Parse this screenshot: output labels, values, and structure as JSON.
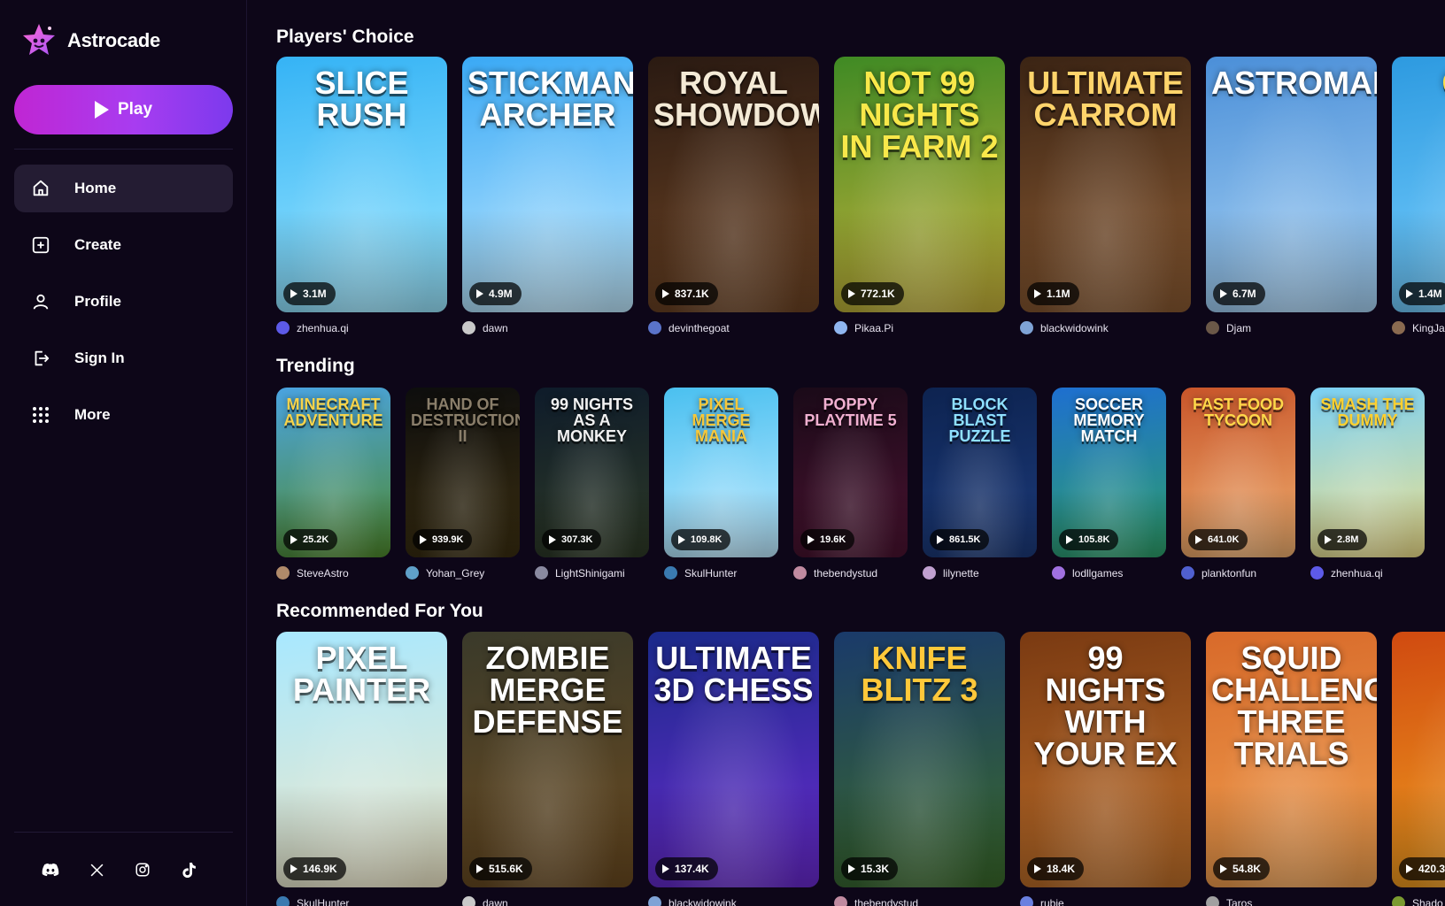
{
  "app": {
    "name": "Astrocade"
  },
  "sidebar": {
    "play_label": "Play",
    "nav": [
      {
        "label": "Home",
        "icon": "home-icon",
        "active": true
      },
      {
        "label": "Create",
        "icon": "plus-square-icon",
        "active": false
      },
      {
        "label": "Profile",
        "icon": "user-icon",
        "active": false
      },
      {
        "label": "Sign In",
        "icon": "sign-in-icon",
        "active": false
      },
      {
        "label": "More",
        "icon": "grid-icon",
        "active": false
      }
    ],
    "social": [
      "discord-icon",
      "x-icon",
      "instagram-icon",
      "tiktok-icon"
    ]
  },
  "sections": [
    {
      "title": "Players' Choice",
      "size": "big",
      "games": [
        {
          "title": "Slice Rush",
          "plays": "3.1M",
          "author": "zhenhua.qi",
          "bg": [
            "#35b3f5",
            "#9be7ff"
          ],
          "avatar": "#5d5ae8",
          "title_color": "#ffffff"
        },
        {
          "title": "Stickman Archer",
          "plays": "4.9M",
          "author": "dawn",
          "bg": [
            "#3aa9f5",
            "#bfe9ff"
          ],
          "avatar": "#c9c9c9",
          "title_color": "#ffffff"
        },
        {
          "title": "Royal Showdown",
          "plays": "837.1K",
          "author": "devinthegoat",
          "bg": [
            "#2a1a12",
            "#6e4424"
          ],
          "avatar": "#5a73c9",
          "title_color": "#f4ead6"
        },
        {
          "title": "Not 99 Nights in Farm 2",
          "plays": "772.1K",
          "author": "Pikaa.Pi",
          "bg": [
            "#3f8a24",
            "#c7b23a"
          ],
          "avatar": "#8fb6f0",
          "title_color": "#f9e84a"
        },
        {
          "title": "Ultimate Carrom",
          "plays": "1.1M",
          "author": "blackwidowink",
          "bg": [
            "#3b2414",
            "#8a5a32"
          ],
          "avatar": "#7fa3d6",
          "title_color": "#ffd46b"
        },
        {
          "title": "Astroman",
          "plays": "6.7M",
          "author": "Djam",
          "bg": [
            "#4b8fd8",
            "#a9d4f5"
          ],
          "avatar": "#6b5848",
          "title_color": "#ffffff"
        },
        {
          "title": "Gun",
          "plays": "1.4M",
          "author": "KingJa",
          "bg": [
            "#2d9ae0",
            "#7ad0ff"
          ],
          "avatar": "#8a6a50",
          "title_color": "#ffe04a"
        }
      ]
    },
    {
      "title": "Trending",
      "size": "small",
      "games": [
        {
          "title": "Minecraft Adventure",
          "plays": "25.2K",
          "author": "SteveAstro",
          "bg": [
            "#4aa3e0",
            "#4f8a2c"
          ],
          "avatar": "#b08a6a",
          "title_color": "#f7d34a"
        },
        {
          "title": "Hand of Destruction II",
          "plays": "939.9K",
          "author": "Yohan_Grey",
          "bg": [
            "#0d0d0d",
            "#3a2e10"
          ],
          "avatar": "#5fa0c8",
          "title_color": "#8a7e6a"
        },
        {
          "title": "99 Nights as a Monkey",
          "plays": "307.3K",
          "author": "LightShinigami",
          "bg": [
            "#0e1b2a",
            "#2e3a26"
          ],
          "avatar": "#8a8aa0",
          "title_color": "#f2f2f2"
        },
        {
          "title": "Pixel Merge Mania",
          "plays": "109.8K",
          "author": "SkulHunter",
          "bg": [
            "#4ac0f0",
            "#bfeaff"
          ],
          "avatar": "#3a7ab0",
          "title_color": "#f6c73a"
        },
        {
          "title": "Poppy Playtime 5",
          "plays": "19.6K",
          "author": "thebendystud",
          "bg": [
            "#1a0a18",
            "#4a1230"
          ],
          "avatar": "#c08aa0",
          "title_color": "#f0b0d0"
        },
        {
          "title": "Block Blast Puzzle",
          "plays": "861.5K",
          "author": "lilynette",
          "bg": [
            "#0d2350",
            "#1c3a7a"
          ],
          "avatar": "#c0a0d0",
          "title_color": "#8fe0ff"
        },
        {
          "title": "Soccer Memory Match",
          "plays": "105.8K",
          "author": "lodllgames",
          "bg": [
            "#1e6fd0",
            "#2ea06a"
          ],
          "avatar": "#a070e0",
          "title_color": "#ffffff"
        },
        {
          "title": "Fast Food Tycoon",
          "plays": "641.0K",
          "author": "planktonfun",
          "bg": [
            "#c8552a",
            "#f0b070"
          ],
          "avatar": "#5060d0",
          "title_color": "#ffd84a"
        },
        {
          "title": "Smash the Dummy",
          "plays": "2.8M",
          "author": "zhenhua.qi",
          "bg": [
            "#7ad0f5",
            "#f0e08a"
          ],
          "avatar": "#5d5ae8",
          "title_color": "#ffd02e"
        }
      ]
    },
    {
      "title": "Recommended For You",
      "size": "big",
      "games": [
        {
          "title": "Pixel Painter",
          "plays": "146.9K",
          "author": "SkulHunter",
          "bg": [
            "#a8e8ff",
            "#f0e8c8"
          ],
          "avatar": "#3a7ab0",
          "title_color": "#ffffff"
        },
        {
          "title": "Zombie Merge Defense",
          "plays": "515.6K",
          "author": "dawn",
          "bg": [
            "#3a3a2a",
            "#6a4a20"
          ],
          "avatar": "#c9c9c9",
          "title_color": "#ffffff"
        },
        {
          "title": "Ultimate 3D Chess",
          "plays": "137.4K",
          "author": "blackwidowink",
          "bg": [
            "#1a2a8a",
            "#6a2ad0"
          ],
          "avatar": "#7fa3d6",
          "title_color": "#ffffff"
        },
        {
          "title": "Knife Blitz 3",
          "plays": "15.3K",
          "author": "thebendystud",
          "bg": [
            "#1a3a6a",
            "#3a6a2a"
          ],
          "avatar": "#c08aa0",
          "title_color": "#ffc83a"
        },
        {
          "title": "99 Nights with Your Ex",
          "plays": "18.4K",
          "author": "rubie",
          "bg": [
            "#7a3a12",
            "#c0702a"
          ],
          "avatar": "#6a80e0",
          "title_color": "#ffffff"
        },
        {
          "title": "Squid Challenge Three Trials",
          "plays": "54.8K",
          "author": "Taros",
          "bg": [
            "#d86a2a",
            "#f0a050"
          ],
          "avatar": "#a0a0a0",
          "title_color": "#ffffff"
        },
        {
          "title": "",
          "plays": "420.3",
          "author": "Shado",
          "bg": [
            "#d04a10",
            "#f0a020"
          ],
          "avatar": "#7a9a30",
          "title_color": "#ffffff"
        }
      ]
    }
  ]
}
